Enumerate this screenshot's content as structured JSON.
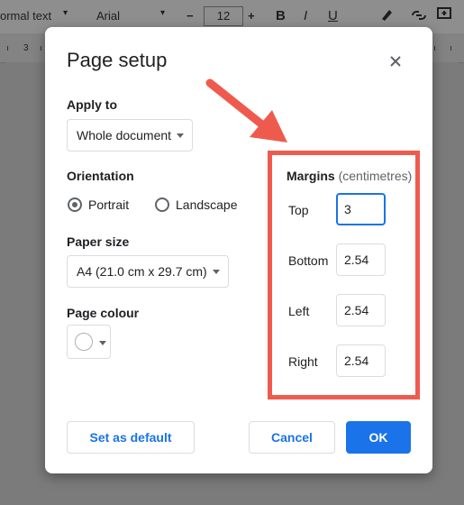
{
  "background_toolbar": {
    "style_select": "ormal text",
    "font_select": "Arial",
    "font_size": "12",
    "ruler_number": "3"
  },
  "dialog": {
    "title": "Page setup",
    "apply_to": {
      "label": "Apply to",
      "value": "Whole document"
    },
    "orientation": {
      "label": "Orientation",
      "options": [
        "Portrait",
        "Landscape"
      ],
      "selected": "Portrait"
    },
    "paper_size": {
      "label": "Paper size",
      "value": "A4 (21.0 cm x 29.7 cm)"
    },
    "page_colour": {
      "label": "Page colour",
      "value": "#ffffff"
    },
    "margins": {
      "label": "Margins",
      "unit": "(centimetres)",
      "fields": [
        {
          "name": "Top",
          "value": "3"
        },
        {
          "name": "Bottom",
          "value": "2.54"
        },
        {
          "name": "Left",
          "value": "2.54"
        },
        {
          "name": "Right",
          "value": "2.54"
        }
      ]
    },
    "buttons": {
      "set_default": "Set as default",
      "cancel": "Cancel",
      "ok": "OK"
    }
  },
  "colors": {
    "accent": "#1a73e8",
    "highlight": "#ee5b4e",
    "overlay": "#7b7b7b"
  }
}
